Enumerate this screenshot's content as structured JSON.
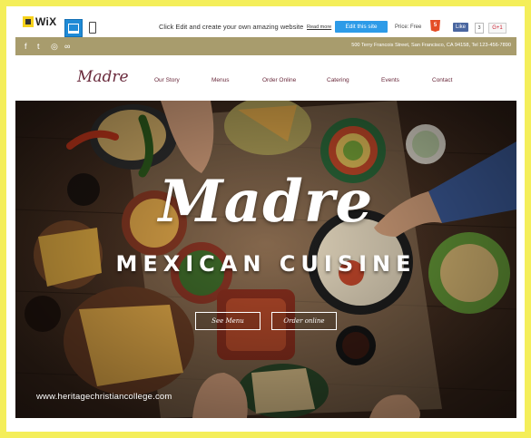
{
  "wix_toolbar": {
    "logo_text": "WiX",
    "promo_text": "Click Edit and create your own amazing website",
    "read_more": "Read more",
    "edit_button": "Edit this site",
    "price": "Price: Free",
    "fb_like": "Like",
    "fb_count": "3",
    "gplus": "G+1"
  },
  "infobar": {
    "social": [
      "f",
      "t",
      "◎",
      "∞"
    ],
    "address": "500 Terry Francois Street, San Francisco, CA 94158, Tel 123-456-7890"
  },
  "nav": {
    "brand": "Madre",
    "items": [
      "Our Story",
      "Menus",
      "Order Online",
      "Catering",
      "Events",
      "Contact"
    ]
  },
  "hero": {
    "title": "Madre",
    "subtitle": "MEXICAN CUISINE",
    "btn_menu": "See Menu",
    "btn_order": "Order online"
  },
  "watermark": "www.heritagechristiancollege.com",
  "colors": {
    "page_border": "#f4ee5a",
    "info_bar": "#a89c6d",
    "nav_text": "#6a2a3c",
    "edit_button": "#2d9be8"
  }
}
